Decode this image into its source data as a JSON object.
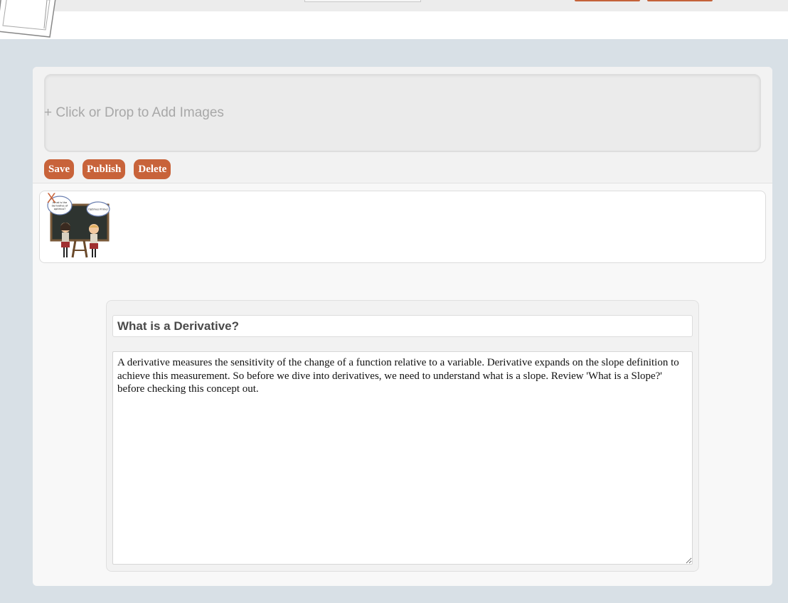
{
  "upload": {
    "dropzone_label": "+ Click or Drop to Add Images"
  },
  "actions": {
    "save_label": "Save",
    "publish_label": "Publish",
    "delete_label": "Delete"
  },
  "images": [
    {
      "remove_label": "X",
      "thumbnail_icon": "cartoon-chalkboard-thumbnail",
      "bubble_left": "What is the derivative of optimus?",
      "bubble_right": "Optimus Prime!"
    }
  ],
  "concept": {
    "title": "What is a Derivative?",
    "body": "A derivative measures the sensitivity of the change of a function relative to a variable. Derivative expands on the slope definition to achieve this measurement. So before we dive into derivatives, we need to understand what is a slope. Review 'What is a Slope?' before checking this concept out."
  },
  "colors": {
    "accent": "#c8633a",
    "page_bg": "#d8e0e6",
    "card_bg": "#f8f8f8"
  }
}
